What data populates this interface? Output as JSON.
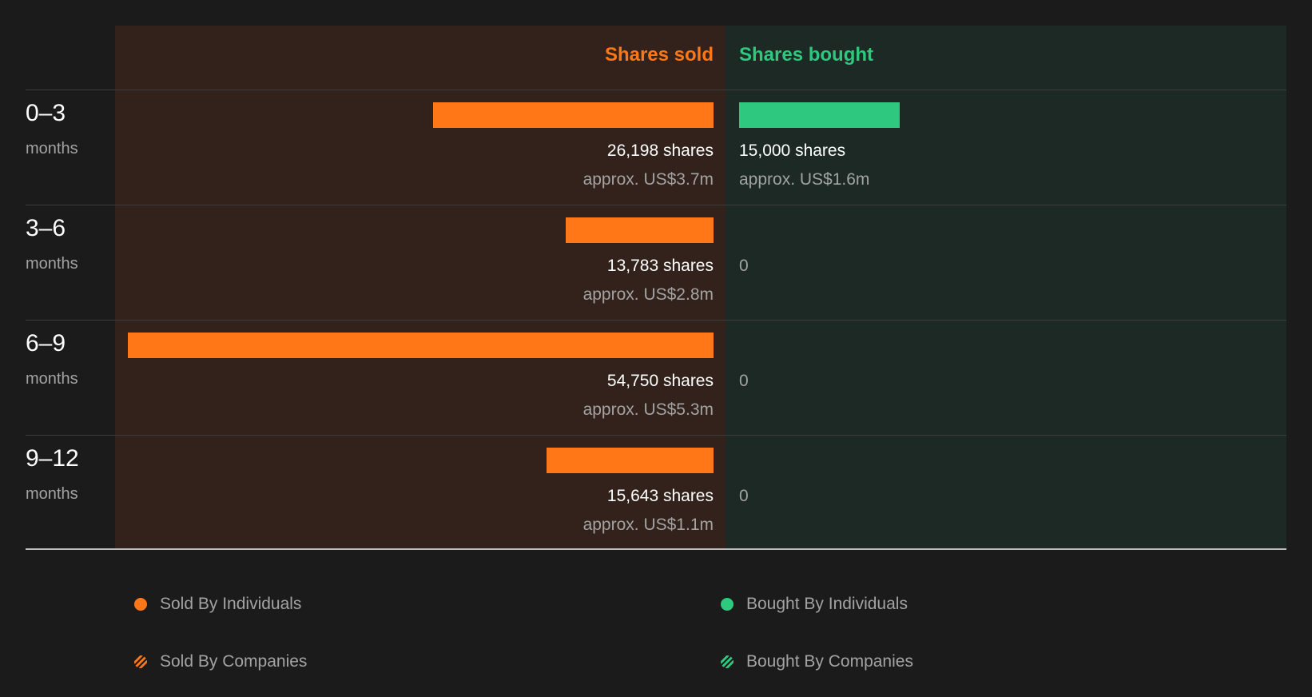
{
  "colors": {
    "sold": "#ff7717",
    "bought": "#2fc87f",
    "sold_bg": "#33221b",
    "bought_bg": "#1c2925"
  },
  "header": {
    "sold_label": "Shares sold",
    "bought_label": "Shares bought"
  },
  "rows": [
    {
      "range": "0–3",
      "unit": "months",
      "sold_shares": "26,198 shares",
      "sold_value": "approx. US$3.7m",
      "bought_shares": "15,000 shares",
      "bought_value": "approx. US$1.6m"
    },
    {
      "range": "3–6",
      "unit": "months",
      "sold_shares": "13,783 shares",
      "sold_value": "approx. US$2.8m",
      "bought_shares": "0",
      "bought_value": ""
    },
    {
      "range": "6–9",
      "unit": "months",
      "sold_shares": "54,750 shares",
      "sold_value": "approx. US$5.3m",
      "bought_shares": "0",
      "bought_value": ""
    },
    {
      "range": "9–12",
      "unit": "months",
      "sold_shares": "15,643 shares",
      "sold_value": "approx. US$1.1m",
      "bought_shares": "0",
      "bought_value": ""
    }
  ],
  "legend": [
    {
      "label": "Sold By Individuals",
      "icon": "solid-dot",
      "color": "#ff7717"
    },
    {
      "label": "Bought By Individuals",
      "icon": "solid-dot",
      "color": "#2fc87f"
    },
    {
      "label": "Sold By Companies",
      "icon": "striped-dot",
      "color": "#ff7717"
    },
    {
      "label": "Bought By Companies",
      "icon": "striped-dot",
      "color": "#2fc87f"
    }
  ],
  "chart_data": {
    "type": "bar",
    "categories": [
      "0–3 months",
      "3–6 months",
      "6–9 months",
      "9–12 months"
    ],
    "series": [
      {
        "name": "Shares sold",
        "values": [
          26198,
          13783,
          54750,
          15643
        ]
      },
      {
        "name": "Shares bought",
        "values": [
          15000,
          0,
          0,
          0
        ]
      }
    ],
    "value_labels_usd_m": {
      "sold": [
        3.7,
        2.8,
        5.3,
        1.1
      ],
      "bought": [
        1.6,
        0,
        0,
        0
      ]
    },
    "title": "",
    "xlabel": "",
    "ylabel": "",
    "grid": false,
    "legend_placement": "bottom"
  }
}
